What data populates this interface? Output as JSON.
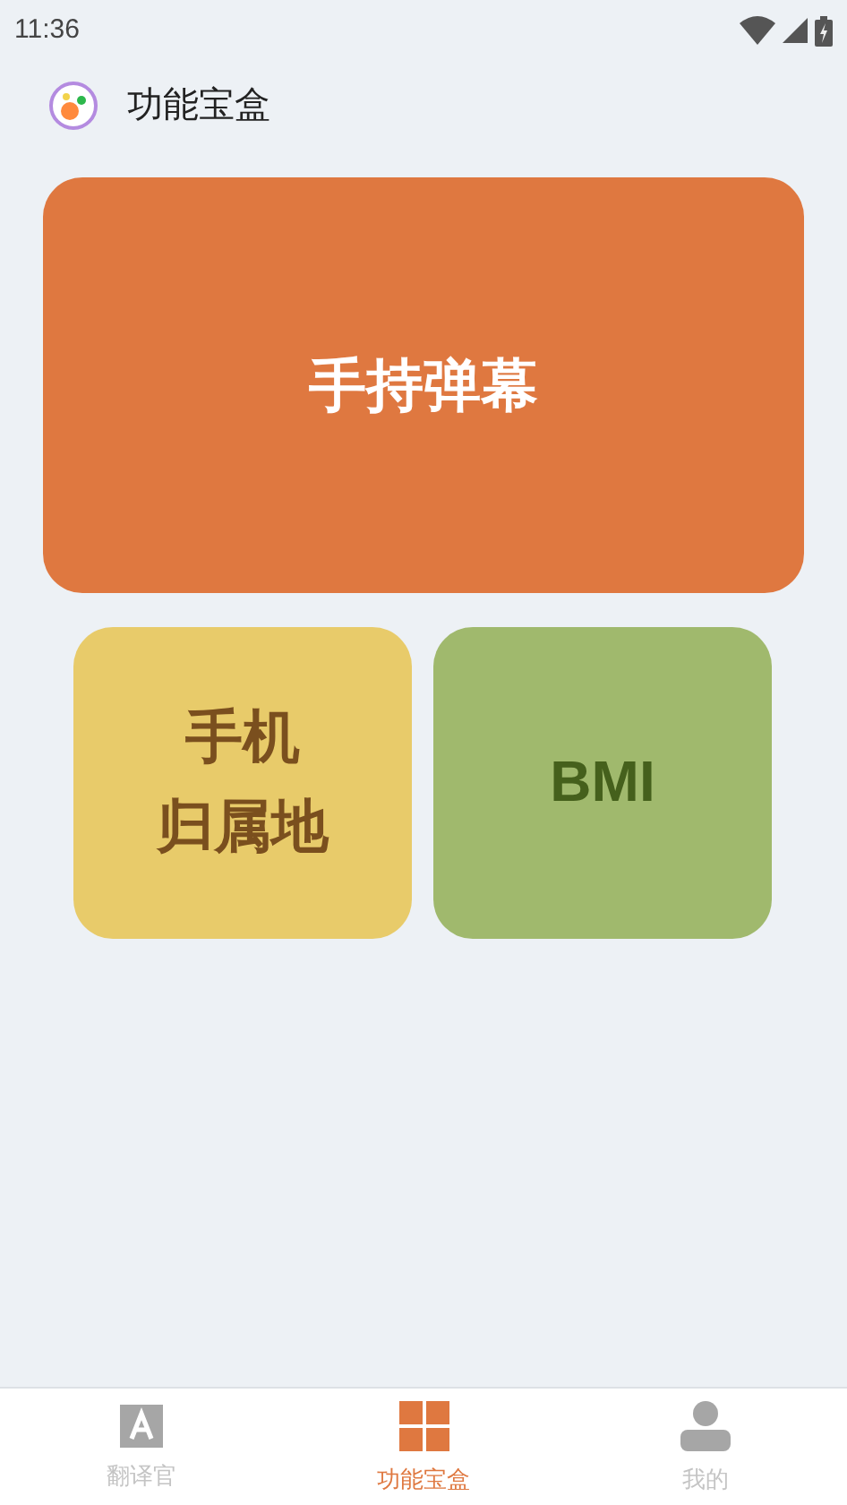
{
  "status_bar": {
    "time": "11:36"
  },
  "header": {
    "title": "功能宝盒"
  },
  "cards": [
    {
      "kind": "wide",
      "label": "手持弹幕",
      "color": "#df7840"
    },
    {
      "kind": "tile",
      "lines": [
        "手机",
        "归属地"
      ],
      "color": "#e8cb6a"
    },
    {
      "kind": "tile",
      "lines": [
        "BMI"
      ],
      "color": "#a0b96d"
    }
  ],
  "tabs": [
    {
      "kind": "translate",
      "label": "翻译官",
      "selected": false
    },
    {
      "kind": "toolbox",
      "label": "功能宝盒",
      "selected": true
    },
    {
      "kind": "profile",
      "label": "我的",
      "selected": false
    }
  ]
}
